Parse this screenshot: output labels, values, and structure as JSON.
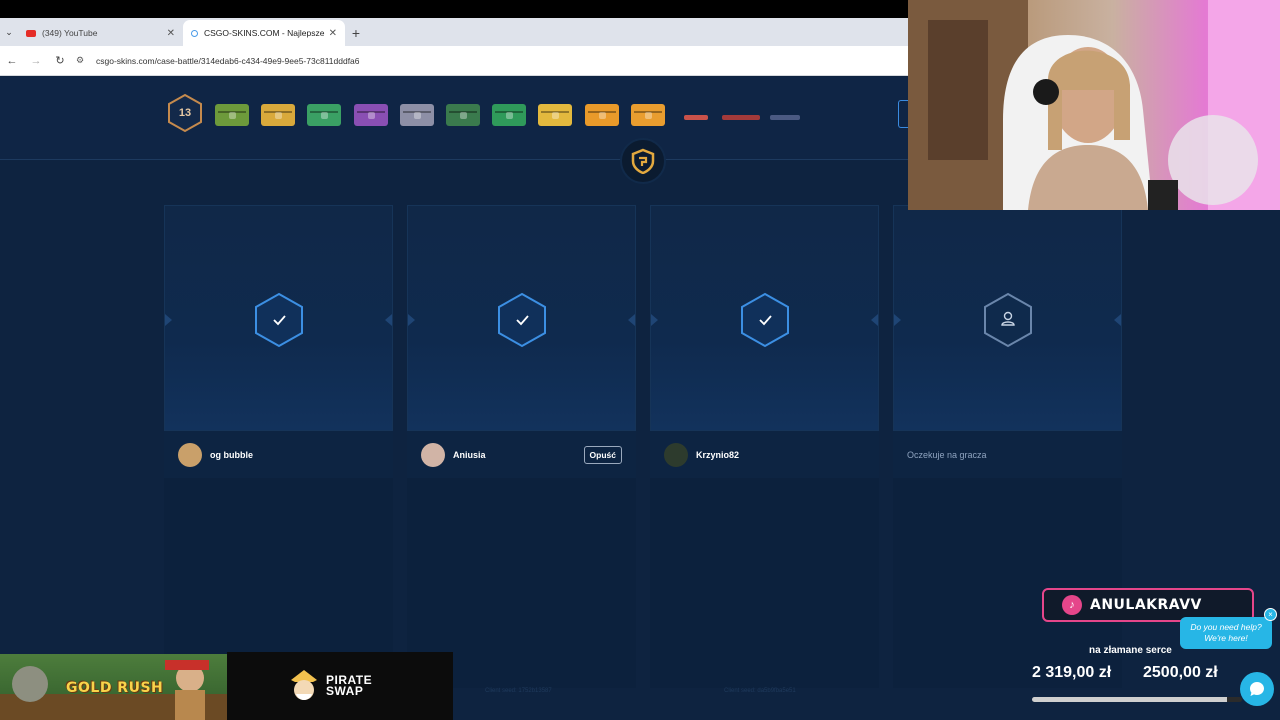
{
  "browser": {
    "menu_icon": "chevron-down-icon",
    "tabs": [
      {
        "title": "(349) YouTube",
        "close": "✕"
      },
      {
        "title": "CSGO-SKINS.COM - Najlepsze",
        "close": "✕"
      }
    ],
    "new_tab": "+",
    "url": "csgo-skins.com/case-battle/314edab6-c434-49e9-9ee5-73c811dddfa6"
  },
  "battle": {
    "round": "13",
    "case_colors": [
      "#6d9a3b",
      "#d9a93b",
      "#3aa064",
      "#8a4fb3",
      "#8d8fa6",
      "#3a7a4d",
      "#2f9a5a",
      "#e3b93e",
      "#e99a2a",
      "#e99d2f"
    ],
    "gun_colors": [
      "#c9524a",
      "#a33a3a",
      "#4b5a82"
    ]
  },
  "players": [
    {
      "name": "og bubble",
      "status": "ready",
      "leave_label": ""
    },
    {
      "name": "Aniusia",
      "status": "ready",
      "leave_label": "Opuść"
    },
    {
      "name": "Krzynio82",
      "status": "ready",
      "leave_label": ""
    },
    {
      "name": "Oczekuje na gracza",
      "status": "waiting",
      "leave_label": ""
    }
  ],
  "seeds": [
    "Client seed: 1752b13587",
    "Client seed: da5b9fba5e51"
  ],
  "ads": {
    "gold_rush": "GOLD RUSH",
    "pirate_swap_line1": "PIRATE",
    "pirate_swap_line2": "SWAP"
  },
  "donation": {
    "tiktok_name": "ANULAKRAVV",
    "goal_title": "na złamane serce",
    "current": "2 319,00 zł",
    "target": "2500,00 zł",
    "progress": 0.9276
  },
  "help": {
    "line1": "Do you need help?",
    "line2": "We're here!",
    "close": "×"
  }
}
